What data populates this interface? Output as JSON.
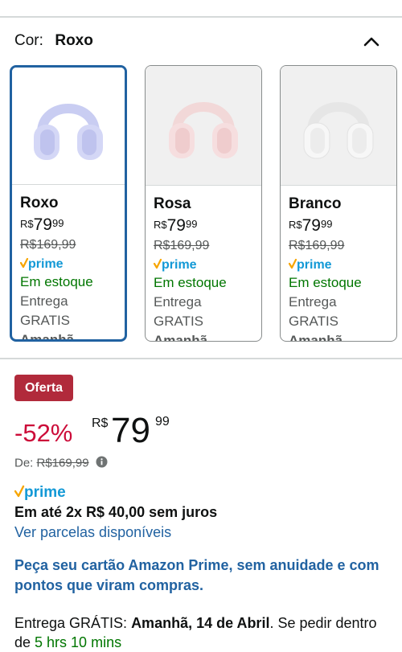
{
  "color_selector": {
    "label": "Cor:",
    "selected": "Roxo",
    "collapse_icon": "chevron-up-icon"
  },
  "variants": [
    {
      "name": "Roxo",
      "currency": "R$",
      "price_whole": "79",
      "price_fraction": "99",
      "list_price": "R$169,99",
      "prime_label": "prime",
      "stock": "Em estoque",
      "delivery": "Entrega GRATIS",
      "delivery_day": "Amanhã",
      "selected": true,
      "color": "#d7d9f5"
    },
    {
      "name": "Rosa",
      "currency": "R$",
      "price_whole": "79",
      "price_fraction": "99",
      "list_price": "R$169,99",
      "prime_label": "prime",
      "stock": "Em estoque",
      "delivery": "Entrega GRATIS",
      "delivery_day": "Amanhã",
      "selected": false,
      "color": "#f5dede"
    },
    {
      "name": "Branco",
      "currency": "R$",
      "price_whole": "79",
      "price_fraction": "99",
      "list_price": "R$169,99",
      "prime_label": "prime",
      "stock": "Em estoque",
      "delivery": "Entrega GRATIS",
      "delivery_day": "Amanhã",
      "selected": false,
      "color": "#f4f4f4"
    }
  ],
  "offer": {
    "badge": "Oferta",
    "discount": "-52%",
    "currency": "R$",
    "price_whole": "79",
    "price_fraction": "99",
    "was_label": "De:",
    "was_price": "R$169,99",
    "prime_label": "prime",
    "installments": "Em até 2x R$ 40,00 sem juros",
    "installments_link": "Ver parcelas disponíveis",
    "promo": "Peça seu cartão Amazon Prime, sem anuidade e com pontos que viram compras."
  },
  "shipping": {
    "prefix": "Entrega GRÁTIS: ",
    "date": "Amanhã, 14 de Abril",
    "middle": ". Se pedir dentro de ",
    "countdown": "5 hrs 10 mins"
  },
  "colors": {
    "selected_border": "#2162a1",
    "link": "#2162a1",
    "stock": "#007600",
    "discount": "#cc0c39",
    "badge": "#b12a3b",
    "prime": "#1399d6",
    "prime_check": "#f7a500"
  }
}
